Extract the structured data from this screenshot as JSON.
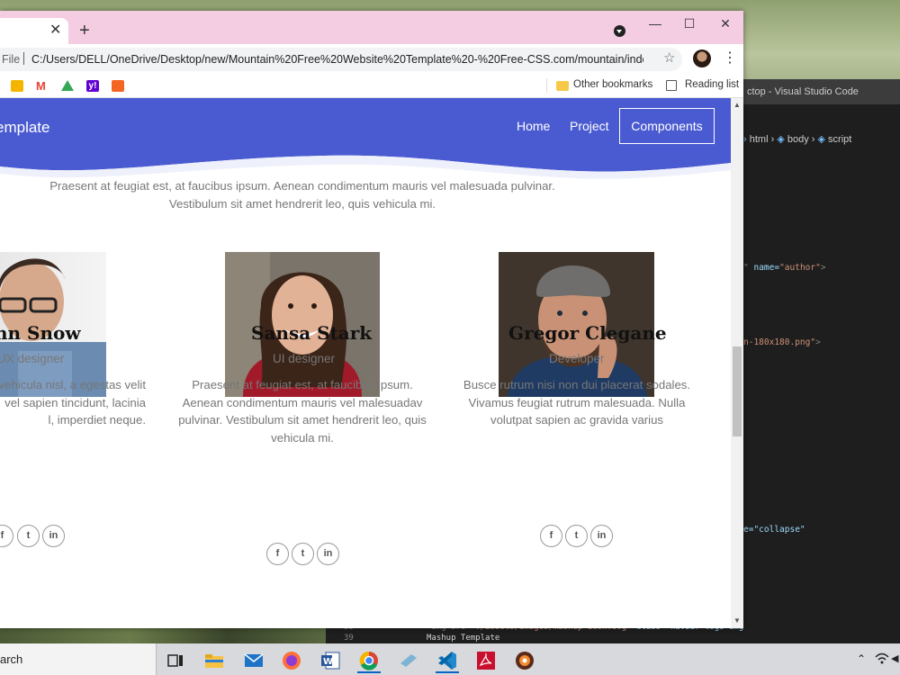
{
  "browser": {
    "url_scheme": "File",
    "url": "C:/Users/DELL/OneDrive/Desktop/new/Mountain%20Free%20Website%20Template%20-%20Free-CSS.com/mountain/index.h...",
    "bookmarks_right": [
      {
        "label": "Other bookmarks",
        "icon": "folder-icon"
      },
      {
        "label": "Reading list",
        "icon": "reading-list-icon"
      }
    ],
    "bookmark_icons": [
      "slides-icon",
      "gmail-icon",
      "drive-icon",
      "yahoo-icon",
      "vertex-icon"
    ]
  },
  "site": {
    "brand": "emplate",
    "nav": [
      {
        "label": "Home"
      },
      {
        "label": "Project"
      }
    ],
    "nav_button": "Components",
    "accent": "#4a5bd1",
    "intro_line1": "Praesent at feugiat est, at faucibus ipsum. Aenean condimentum mauris vel malesuada pulvinar.",
    "intro_line2": "Vestibulum sit amet hendrerit leo, quis vehicula mi."
  },
  "team": [
    {
      "name": "hn Snow",
      "role": "UX designer",
      "bio_lines": [
        "vehicula nisl, a egestas velit",
        "vel sapien tincidunt, lacinia",
        "l, imperdiet neque."
      ]
    },
    {
      "name": "Sansa Stark",
      "role": "UI designer",
      "bio_lines": [
        "Praesent at feugiat est, at faucibus ipsum.",
        "Aenean condimentum mauris vel malesuadav",
        "pulvinar. Vestibulum sit amet hendrerit leo, quis",
        "vehicula mi."
      ]
    },
    {
      "name": "Gregor Clegane",
      "role": "Developer",
      "bio_lines": [
        "Busce rutrum nisi non dui placerat sodales.",
        "Vivamus feugiat rutrum malesuada. Nulla",
        "volutpat sapien ac gravida varius"
      ]
    }
  ],
  "social": {
    "facebook": "f",
    "twitter": "t",
    "linkedin": "in"
  },
  "vscode": {
    "title": "ctop - Visual Studio Code",
    "crumb1": "html",
    "crumb2": "body",
    "crumb3": "script",
    "snip_author_attr": "name=",
    "snip_author_val": "\"author\"",
    "snip_png": "n-180x180.png\"",
    "snip_collapse": "e=\"collapse\"",
    "line38": "38",
    "line39": "39",
    "code38_a": "<img src=\"",
    "code38_b": "./assets/images/mashup-icon.svg",
    "code38_c": "\" class=\"navbar-logo-img\" alt=\"\">",
    "code39": "Mashup Template"
  },
  "taskbar": {
    "search_text": "arch"
  }
}
